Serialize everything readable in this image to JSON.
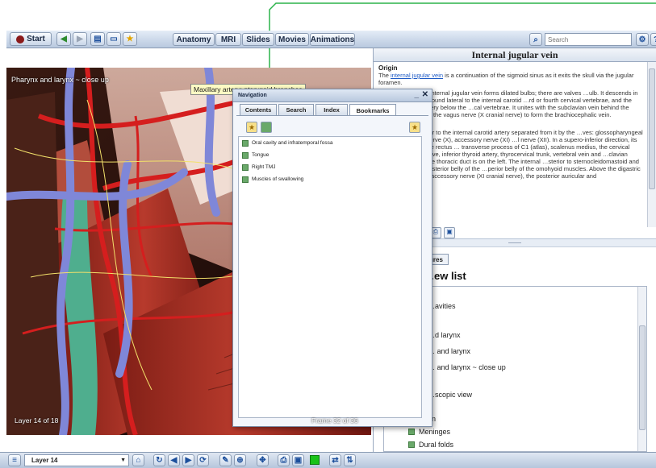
{
  "toolbar": {
    "start_label": "Start",
    "tabs": [
      {
        "label": "Anatomy"
      },
      {
        "label": "MRI"
      },
      {
        "label": "Slides"
      },
      {
        "label": "Movies"
      },
      {
        "label": "Animations"
      }
    ],
    "search_placeholder": "Search"
  },
  "viewer": {
    "title": "Pharynx and larynx ~ close up",
    "tooltip": "Maxillary artery: pterygoid branches",
    "layer_text": "Layer 14 of 18",
    "frame_text": "Frame 32 of 36"
  },
  "info": {
    "title": "Internal jugular vein",
    "origin_heading": "Origin",
    "origin_pre": "The ",
    "origin_link": "internal jugular vein",
    "origin_post": " is a continuation of the sigmoid sinus as it exits the skull via the jugular foramen.",
    "course_text": "…nferior ends, the internal jugular vein forms dilated bulbs; there are valves …ulb. It descends in the carotid sheath, found lateral to the internal carotid …rd or fourth cervical vertebrae, and the common carotid artery below the …cal vertebrae. It unites with the subclavian vein behind the sternal end of …r to the vagus nerve (X cranial nerve) to form the brachiocephalic vein.",
    "relations_heading": "…ations",
    "relations_text": "…kull it lies posterior to the internal carotid artery separated from it by the …ves: glossopharyngeal nerve (IX), vagus nerve (X), accessory nerve (XI) …l nerve (XII). In a supero-inferior direction, its anterior relations are rectus … transverse process of C1 (atlas), scalenus medius, the cervical plexus, …hrenic nerve, inferior thyroid artery, thyrocervical trunk, vertebral vein and …clavian artery; in addition the thoracic duct is on the left. The internal …sterior to sternocleidomastoid and is crossed by the posterior belly of the …perior belly of the omohyoid muscles. Above the digastric muscle it is …y the accessory nerve (XI cranial nerve), the posterior auricular and"
  },
  "lower_panel": {
    "tab_label": "…uctures",
    "heading": "…ew list",
    "items": [
      {
        "label": "…avities"
      },
      {
        "label": "…d larynx"
      },
      {
        "label": "… and larynx"
      },
      {
        "label": "… and larynx ~ close up"
      },
      {
        "label": "…scopic view"
      },
      {
        "label": "Brain"
      },
      {
        "label": "Meninges"
      },
      {
        "label": "Dural folds"
      }
    ]
  },
  "navigation": {
    "title": "Navigation",
    "tabs": [
      {
        "label": "Contents"
      },
      {
        "label": "Search"
      },
      {
        "label": "Index"
      },
      {
        "label": "Bookmarks"
      }
    ],
    "bookmarks": [
      {
        "label": "Oral cavity and infratemporal fossa"
      },
      {
        "label": "Tongue"
      },
      {
        "label": "Right TMJ"
      },
      {
        "label": "Muscles of swallowing"
      }
    ]
  },
  "bottombar": {
    "layer_select": "Layer 14"
  },
  "colors": {
    "accent": "#1c4f9c",
    "active_green": "#19c219",
    "connector_green": "#2bb34a"
  }
}
